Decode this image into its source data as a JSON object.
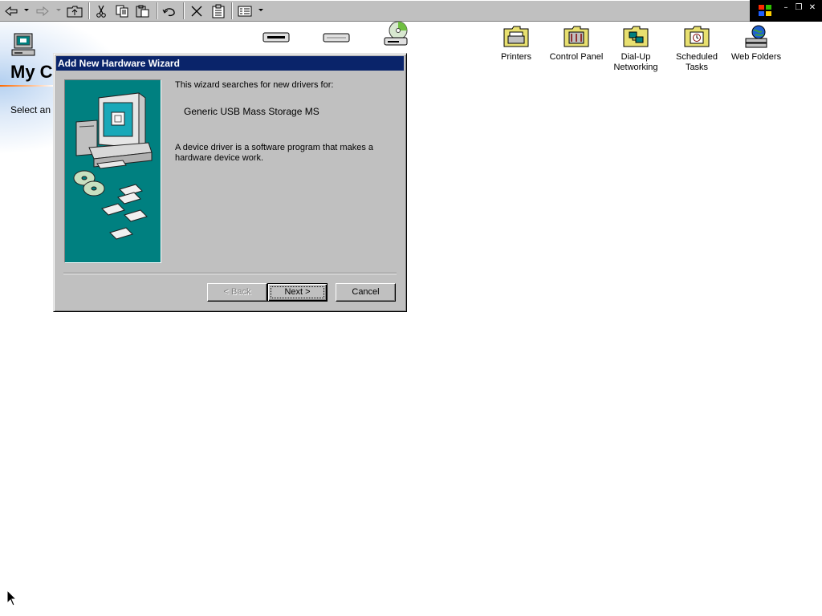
{
  "toolbar": {
    "buttons": [
      "back-icon",
      "forward-icon",
      "up-folder-icon",
      "cut-icon",
      "copy-icon",
      "paste-icon",
      "undo-icon",
      "delete-icon",
      "properties-icon",
      "views-icon"
    ]
  },
  "folder": {
    "title": "My Computer",
    "prompt": "Select an item to view its description."
  },
  "desktop_items": [
    {
      "label": "Printers",
      "icon": "printers-folder-icon"
    },
    {
      "label": "Control Panel",
      "icon": "control-panel-folder-icon"
    },
    {
      "label": "Dial-Up Networking",
      "icon": "dial-up-networking-folder-icon"
    },
    {
      "label": "Scheduled Tasks",
      "icon": "scheduled-tasks-folder-icon"
    },
    {
      "label": "Web Folders",
      "icon": "web-folders-icon"
    }
  ],
  "dialog": {
    "title": "Add New Hardware Wizard",
    "intro": "This wizard searches for new drivers for:",
    "device": "Generic USB Mass Storage MS",
    "description": "A device driver is a software program that makes a hardware device work.",
    "buttons": {
      "back": "< Back",
      "next": "Next >",
      "cancel": "Cancel"
    }
  },
  "colors": {
    "titlebar": "#0a246a",
    "dialog_face": "#c0c0c0",
    "wizard_art_bg": "#008080"
  }
}
